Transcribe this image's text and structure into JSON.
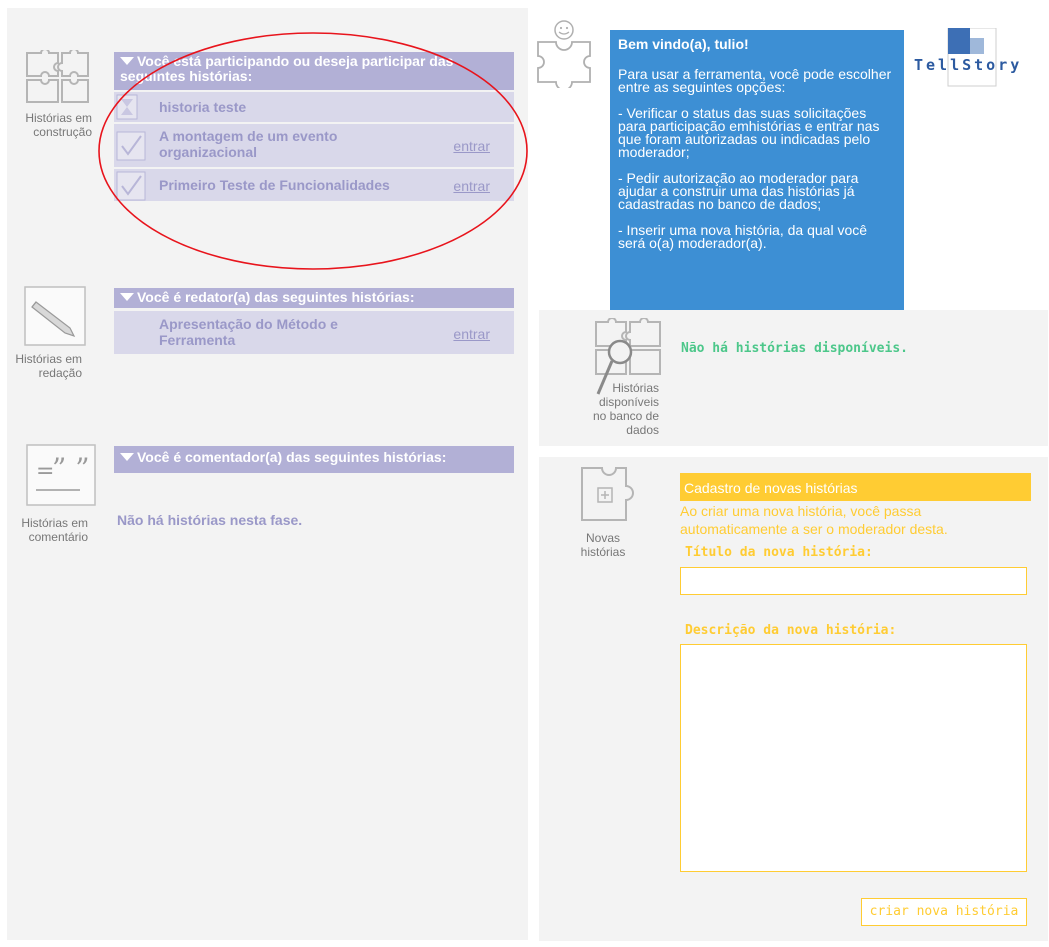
{
  "left": {
    "construction": {
      "icon_label_line1": "Histórias em",
      "icon_label_line2": "construção",
      "header_line1": "Você está participando ou deseja participar das",
      "header_line2": "seguintes histórias:",
      "rows": [
        {
          "title": "historia teste",
          "status_icon": "hourglass-icon",
          "action": ""
        },
        {
          "title_line1": "A montagem de um evento",
          "title_line2": "organizacional",
          "status_icon": "checkmark-icon",
          "action": "entrar"
        },
        {
          "title": "Primeiro Teste de Funcionalidades",
          "status_icon": "checkmark-icon",
          "action": "entrar"
        }
      ]
    },
    "writing": {
      "icon_label_line1": "Histórias em",
      "icon_label_line2": "redação",
      "header": "Você é redator(a) das seguintes histórias:",
      "rows": [
        {
          "title_line1": "Apresentação do Método e",
          "title_line2": "Ferramenta",
          "action": "entrar"
        }
      ]
    },
    "commenting": {
      "icon_label_line1": "Histórias em",
      "icon_label_line2": "comentário",
      "header": "Você é comentador(a) das seguintes histórias:",
      "empty": "Não há histórias nesta fase."
    }
  },
  "welcome": {
    "title": "Bem vindo(a), tulio!",
    "p1": "Para usar a ferramenta, você pode escolher entre as seguintes opções:",
    "p2": "- Verificar o status das suas solicitações para participação emhistórias e entrar nas que foram autorizadas ou indicadas pelo moderador;",
    "p3": "- Pedir autorização ao moderador para ajudar a construir uma das histórias já cadastradas no banco de dados;",
    "p4": "- Inserir uma nova história, da qual você será o(a) moderador(a)."
  },
  "logo": {
    "text": "TellStory"
  },
  "available": {
    "icon_label_line1": "Histórias",
    "icon_label_line2": "disponíveis",
    "icon_label_line3": "no banco de",
    "icon_label_line4": "dados",
    "empty": "Não há histórias disponíveis."
  },
  "new_story": {
    "icon_label_line1": "Novas",
    "icon_label_line2": "histórias",
    "header": "Cadastro de novas histórias",
    "intro_line1": "Ao criar uma nova história, você passa",
    "intro_line2": "automaticamente a ser o moderador desta.",
    "title_label": "Título da nova história:",
    "title_value": "",
    "desc_label": "Descrição da nova história:",
    "desc_value": "",
    "submit": "criar nova história"
  },
  "colors": {
    "lavender_header": "#b2b0d6",
    "lavender_row": "#d9d8ea",
    "lavender_text": "#9a98c8",
    "welcome_blue": "#3d8fd4",
    "yellow": "#ffcc33",
    "green_text": "#4cc78a",
    "annotation_red": "#e8141c"
  }
}
